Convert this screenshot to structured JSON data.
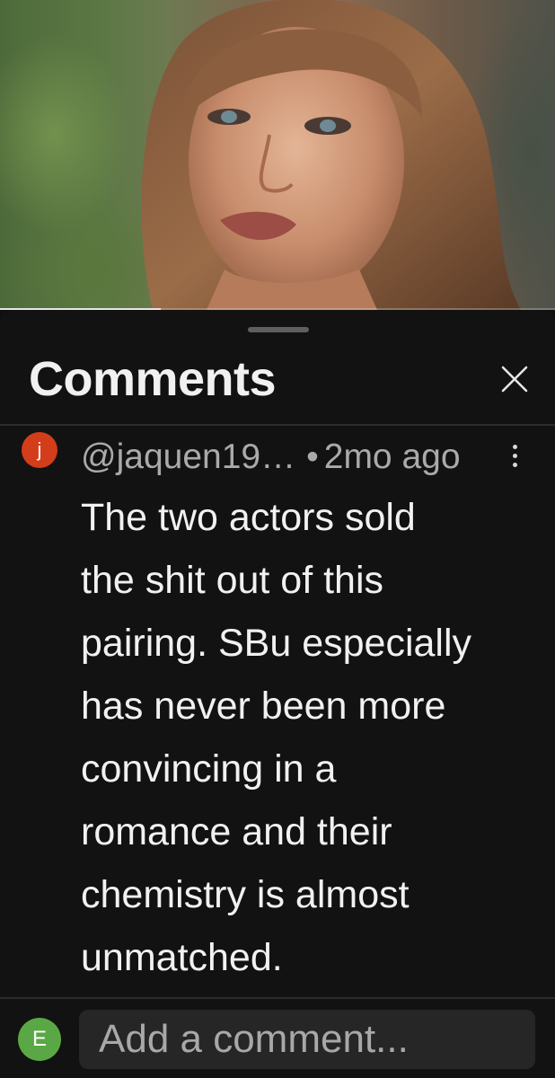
{
  "video": {
    "progress": 0.29
  },
  "comments_panel": {
    "title": "Comments",
    "close_icon": "close-icon",
    "comments": [
      {
        "avatar_letter": "j",
        "avatar_color": "#d43d1a",
        "author": "@jaquen19…",
        "separator": "•",
        "timestamp": "2mo ago",
        "body_lines": [
          "The two actors sold",
          "the shit out of this",
          "pairing. SBu especially",
          "has never been more",
          "convincing in a",
          "romance and their",
          "chemistry is almost",
          "unmatched."
        ]
      }
    ],
    "add_comment": {
      "avatar_letter": "E",
      "avatar_color": "#5aa845",
      "placeholder": "Add a comment..."
    }
  }
}
